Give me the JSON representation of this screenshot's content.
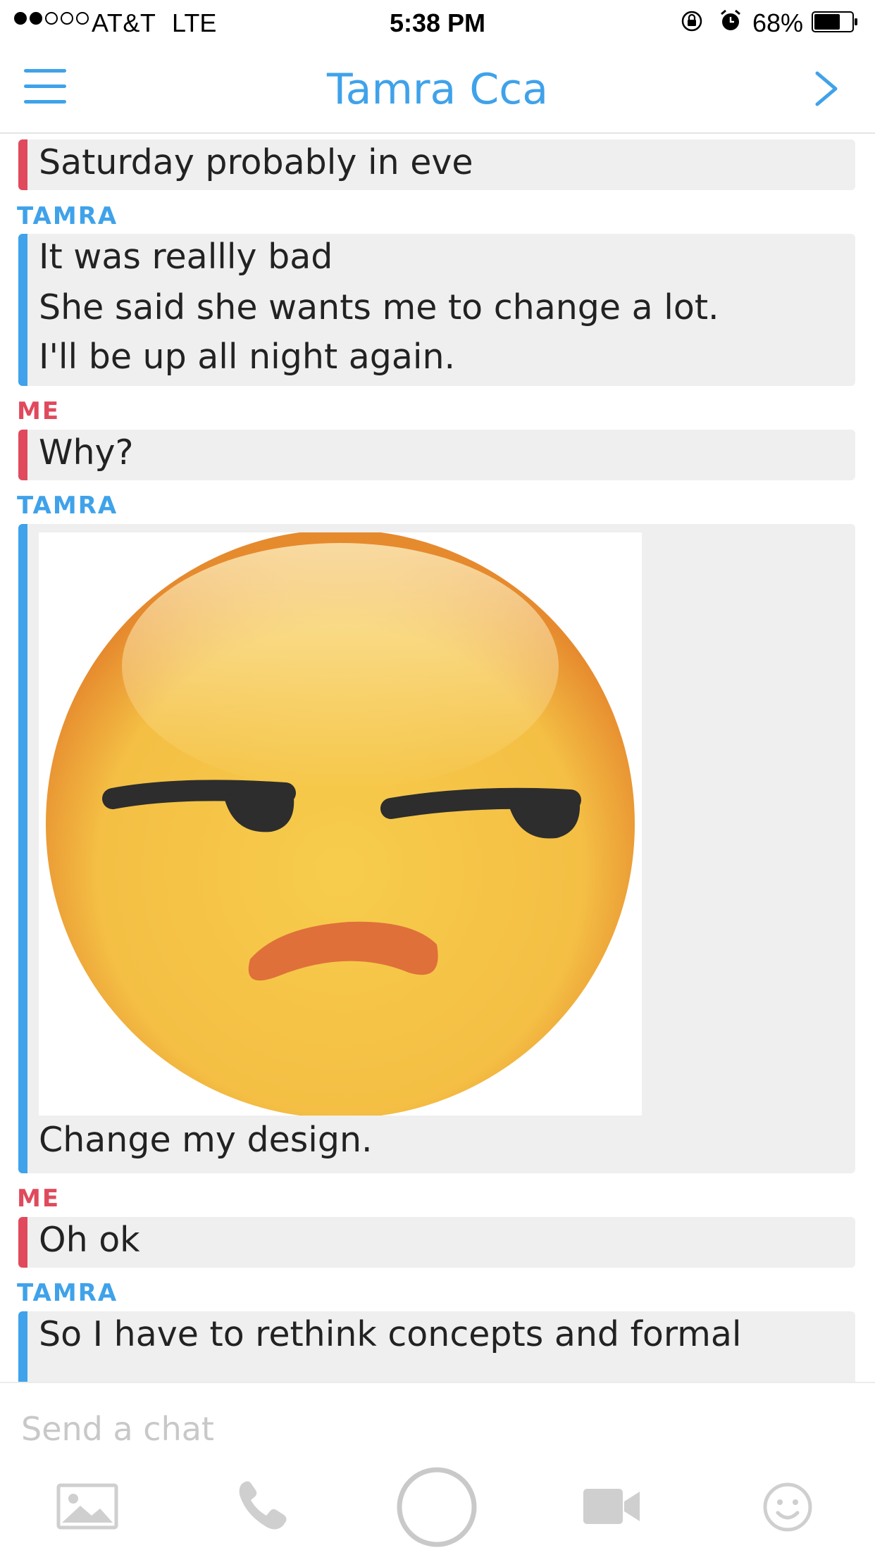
{
  "status_bar": {
    "carrier": "AT&T",
    "network": "LTE",
    "time": "5:38 PM",
    "battery": "68%",
    "signal_bars_filled": 2,
    "signal_bars_total": 5
  },
  "header": {
    "title": "Tamra Cca",
    "menu_icon": "hamburger-menu-icon",
    "next_icon": "chevron-right-icon"
  },
  "messages": [
    {
      "sender": "me",
      "lines": [
        "Saturday probably in eve"
      ]
    },
    {
      "sender": "TAMRA",
      "lines": [
        "It was reallly bad",
        "She said she wants me to change a lot.",
        "I'll be up all night again."
      ]
    },
    {
      "sender": "ME",
      "lines": [
        "Why?"
      ]
    },
    {
      "sender": "TAMRA",
      "image": "unamused-face-emoji",
      "lines": [
        "Change my design."
      ]
    },
    {
      "sender": "ME",
      "lines": [
        "Oh ok"
      ]
    },
    {
      "sender": "TAMRA",
      "lines": [
        "So I have to rethink concepts and formal"
      ]
    }
  ],
  "composer": {
    "placeholder": "Send a chat",
    "icons": [
      "photo-icon",
      "phone-icon",
      "capture-button",
      "video-icon",
      "emoji-icon"
    ]
  },
  "colors": {
    "accent_blue": "#3fa2ea",
    "me_red": "#e04a5c",
    "bubble_bg": "#efefef"
  }
}
